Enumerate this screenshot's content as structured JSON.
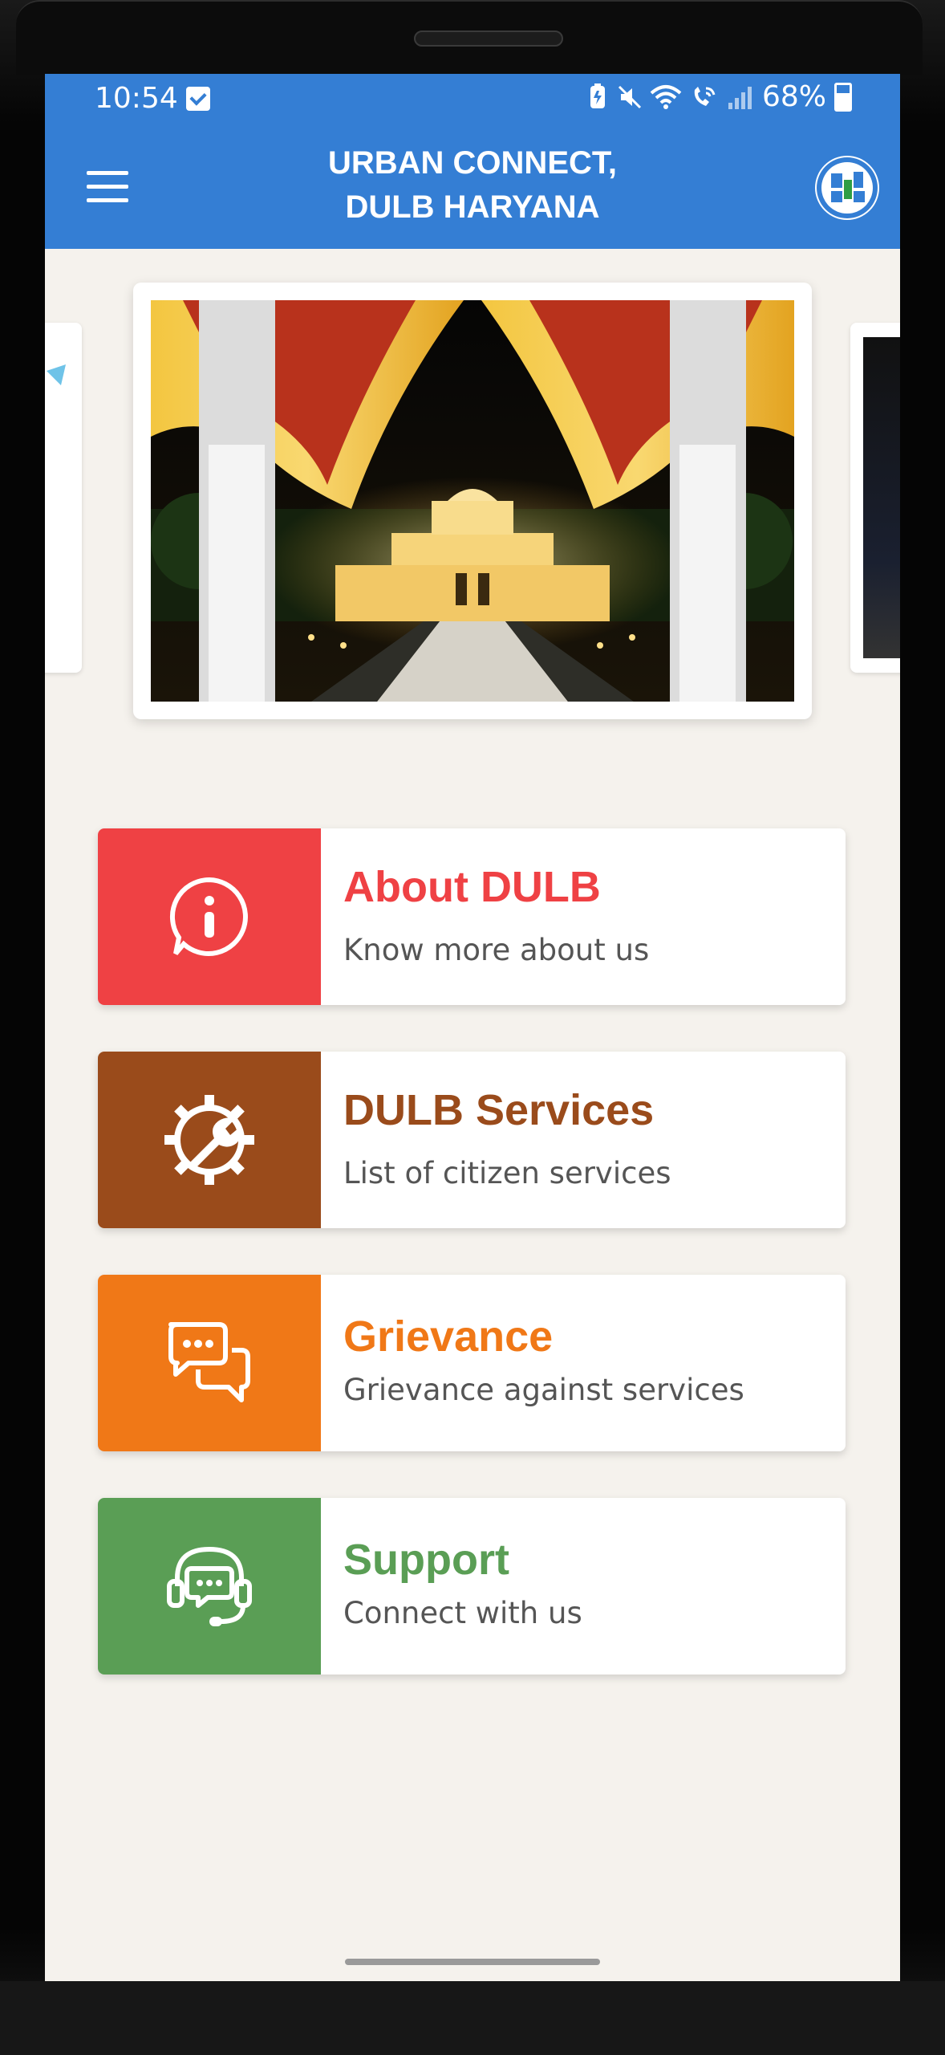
{
  "status_bar": {
    "time": "10:54",
    "battery": "68%"
  },
  "app_bar": {
    "title_line1": "URBAN CONNECT,",
    "title_line2": "DULB HARYANA"
  },
  "carousel": {
    "current_image": "illuminated palace through curtained archway"
  },
  "menu": [
    {
      "title": "About DULB",
      "subtitle": "Know more about us",
      "color": "#ef4144",
      "icon": "info-icon"
    },
    {
      "title": "DULB Services",
      "subtitle": "List of citizen services",
      "color": "#9a4b1b",
      "icon": "gear-wrench-icon"
    },
    {
      "title": "Grievance",
      "subtitle": "Grievance against services",
      "color": "#f07817",
      "icon": "chat-bubbles-icon"
    },
    {
      "title": "Support",
      "subtitle": "Connect with us",
      "color": "#5a9e55",
      "icon": "headset-icon"
    }
  ],
  "colors": {
    "app_bar": "#347ed4",
    "background": "#f5f2ed"
  }
}
